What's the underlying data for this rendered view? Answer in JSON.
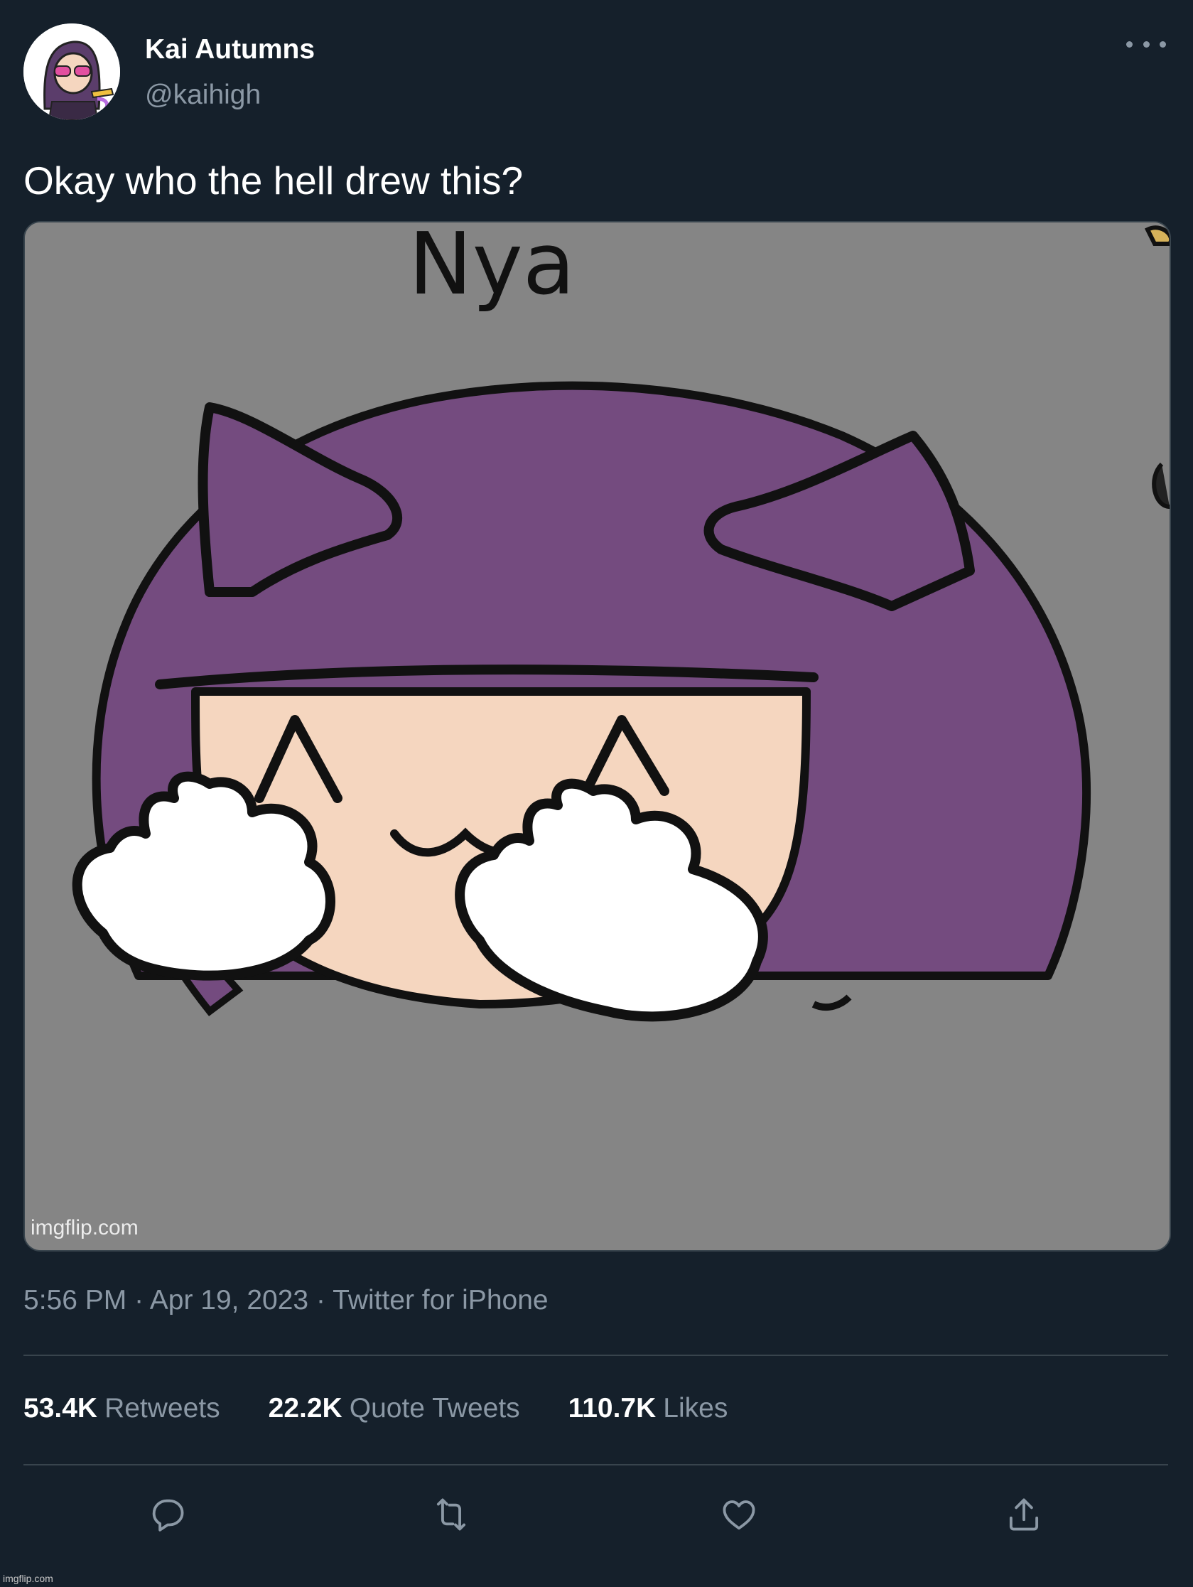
{
  "author": {
    "name": "Kai Autumns",
    "handle": "@kaihigh"
  },
  "tweet": {
    "text": "Okay who the hell drew this?",
    "media": {
      "image_text": "Nya",
      "watermark": "imgflip.com"
    },
    "meta": {
      "time": "5:56 PM",
      "date": "Apr 19, 2023",
      "source": "Twitter for iPhone",
      "separator": "·"
    },
    "stats": {
      "retweets": {
        "count": "53.4K",
        "label": "Retweets"
      },
      "quote_tweets": {
        "count": "22.2K",
        "label": "Quote Tweets"
      },
      "likes": {
        "count": "110.7K",
        "label": "Likes"
      }
    }
  },
  "actions": [
    {
      "icon": "reply-icon"
    },
    {
      "icon": "retweet-icon"
    },
    {
      "icon": "like-icon"
    },
    {
      "icon": "share-icon"
    }
  ],
  "footer_watermark": "imgflip.com",
  "colors": {
    "background": "#15202b",
    "secondary_text": "#8b98a5",
    "divider": "#38444d",
    "hair_purple": "#744b7f",
    "skin": "#f5d6bf",
    "image_bg": "#858585"
  }
}
